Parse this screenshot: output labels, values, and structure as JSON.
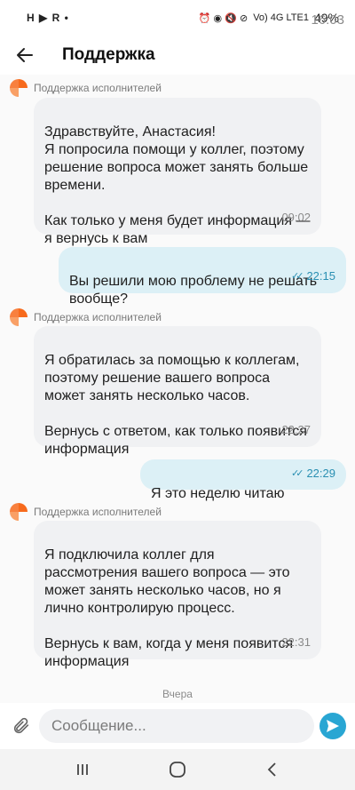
{
  "status_bar": {
    "time": "16:03",
    "left_icons": "H ▶ R •",
    "right_icons": "⏰ ◉ 🔇 ⊘",
    "network": "Vo) 4G LTE1",
    "battery": "49%"
  },
  "header": {
    "title": "Поддержка"
  },
  "messages": [
    {
      "sender": "Поддержка исполнителей",
      "text": "Здравствуйте, Анастасия!\nЯ попросила помощи у коллег, поэтому решение вопроса может занять больше времени.\n\nКак только у меня будет информация — я вернусь к вам",
      "time": "09:02"
    },
    {
      "text": "Вы решили мою проблему не решать вообще?",
      "time": "22:15"
    },
    {
      "sender": "Поддержка исполнителей",
      "text": "Я обратилась за помощью к коллегам, поэтому решение вашего вопроса может занять несколько часов.\n\nВернусь с ответом, как только появится информация",
      "time": "22:27"
    },
    {
      "text": "Я это неделю читаю",
      "time": "22:29"
    },
    {
      "sender": "Поддержка исполнителей",
      "text": "Я подключила коллег для рассмотрения вашего вопроса — это может занять несколько часов, но я лично контролирую процесс.\n\nВернусь к вам, когда у меня появится информация",
      "time": "22:31"
    }
  ],
  "date_separator": "Вчера",
  "composer": {
    "placeholder": "Сообщение..."
  },
  "colors": {
    "brand_orange": "#f76a1c",
    "outgoing_bubble": "#dcf0f6",
    "incoming_bubble": "#f0f1f3",
    "send_button": "#29a6d3"
  }
}
